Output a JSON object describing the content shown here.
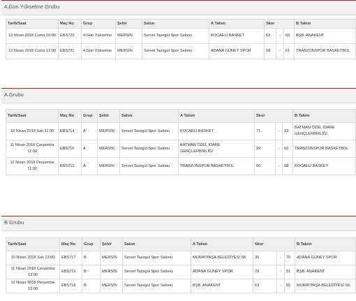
{
  "columns": {
    "date": "Tarih/Saat",
    "code": "Maç No",
    "group": "Grup",
    "city": "Şehir",
    "venue": "Salon",
    "team_a": "A Takım",
    "score": "Skor",
    "team_b": "B Takım"
  },
  "sections": [
    {
      "title": "4.Gün Yükselme Grubu",
      "rows": [
        {
          "date": "13 Nisan 2018 Cuma 10:00",
          "code": "EBS720",
          "group": "4.Gün Yükselme",
          "city": "MERSİN",
          "venue": "Servet Tazegül Spor Salonu",
          "team_a": "KOCAELİ BASKET",
          "score_a": "53",
          "sep": "-",
          "score_b": "63",
          "team_b": "BŞB. ANAKENT"
        },
        {
          "date": "13 Nisan 2018 Cuma 12:00",
          "code": "EBS721",
          "group": "4.Gün Yükselme",
          "city": "MERSİN",
          "venue": "Servet Tazegül Spor Salonu",
          "team_a": "ADANA GÜNEY SPOR",
          "score_a": "58",
          "sep": "-",
          "score_b": "61",
          "team_b": "TRABZONSPOR BASKETBOL"
        }
      ]
    },
    {
      "title": "A Grubu",
      "rows": [
        {
          "date": "10 Nisan 2018 Salı 11:00",
          "code": "EBS714",
          "group": "A",
          "city": "MERSİN",
          "venue": "Servet Tazegül Spor Salonu",
          "team_a": "KOCAELİ BASKET",
          "score_a": "71",
          "sep": "-",
          "score_b": "33",
          "team_b": "BATMAN ÖZEL İDARE GENÇLERBİRLİĞİ"
        },
        {
          "date": "11 Nisan 2018 Çarşamba 11:00",
          "code": "EBS716",
          "group": "A",
          "city": "MERSİN",
          "venue": "Servet Tazegül Spor Salonu",
          "team_a": "BATMAN ÖZEL İDARE GENÇLERBİRLİĞİ",
          "score_a": "29",
          "sep": "-",
          "score_b": "62",
          "team_b": "TRABZONSPOR BASKETBOL"
        },
        {
          "date": "12 Nisan 2018 Perşembe 11:00",
          "code": "EBS715",
          "group": "A",
          "city": "MERSİN",
          "venue": "Servet Tazegül Spor Salonu",
          "team_a": "TRABZONSPOR BASKETBOL",
          "score_a": "66",
          "sep": "-",
          "score_b": "68",
          "team_b": "KOCAELİ BASKET"
        }
      ]
    },
    {
      "title": "B Grubu",
      "rows": [
        {
          "date": "10 Nisan 2018 Salı 13:00",
          "code": "EBS717",
          "group": "B",
          "city": "MERSİN",
          "venue": "Servet Tazegül Spor Salonu",
          "team_a": "MURATPAŞA BELEDİYESİ SK",
          "score_a": "35",
          "sep": "-",
          "score_b": "70",
          "team_b": "ADANA GÜNEY SPOR"
        },
        {
          "date": "11 Nisan 2018 Çarşamba 13:00",
          "code": "EBS719",
          "group": "B",
          "city": "MERSİN",
          "venue": "Servet Tazegül Spor Salonu",
          "team_a": "ADANA GÜNEY SPOR",
          "score_a": "78",
          "sep": "-",
          "score_b": "51",
          "team_b": "BŞB. ANAKENT"
        },
        {
          "date": "12 Nisan 2018 Perşembe 13:00",
          "code": "EBS718",
          "group": "B",
          "city": "MERSİN",
          "venue": "Servet Tazegül Spor Salonu",
          "team_a": "BŞB. ANAKENT",
          "score_a": "63",
          "sep": "-",
          "score_b": "55",
          "team_b": "MURATPAŞA BELEDİYESİ SK"
        }
      ]
    }
  ]
}
